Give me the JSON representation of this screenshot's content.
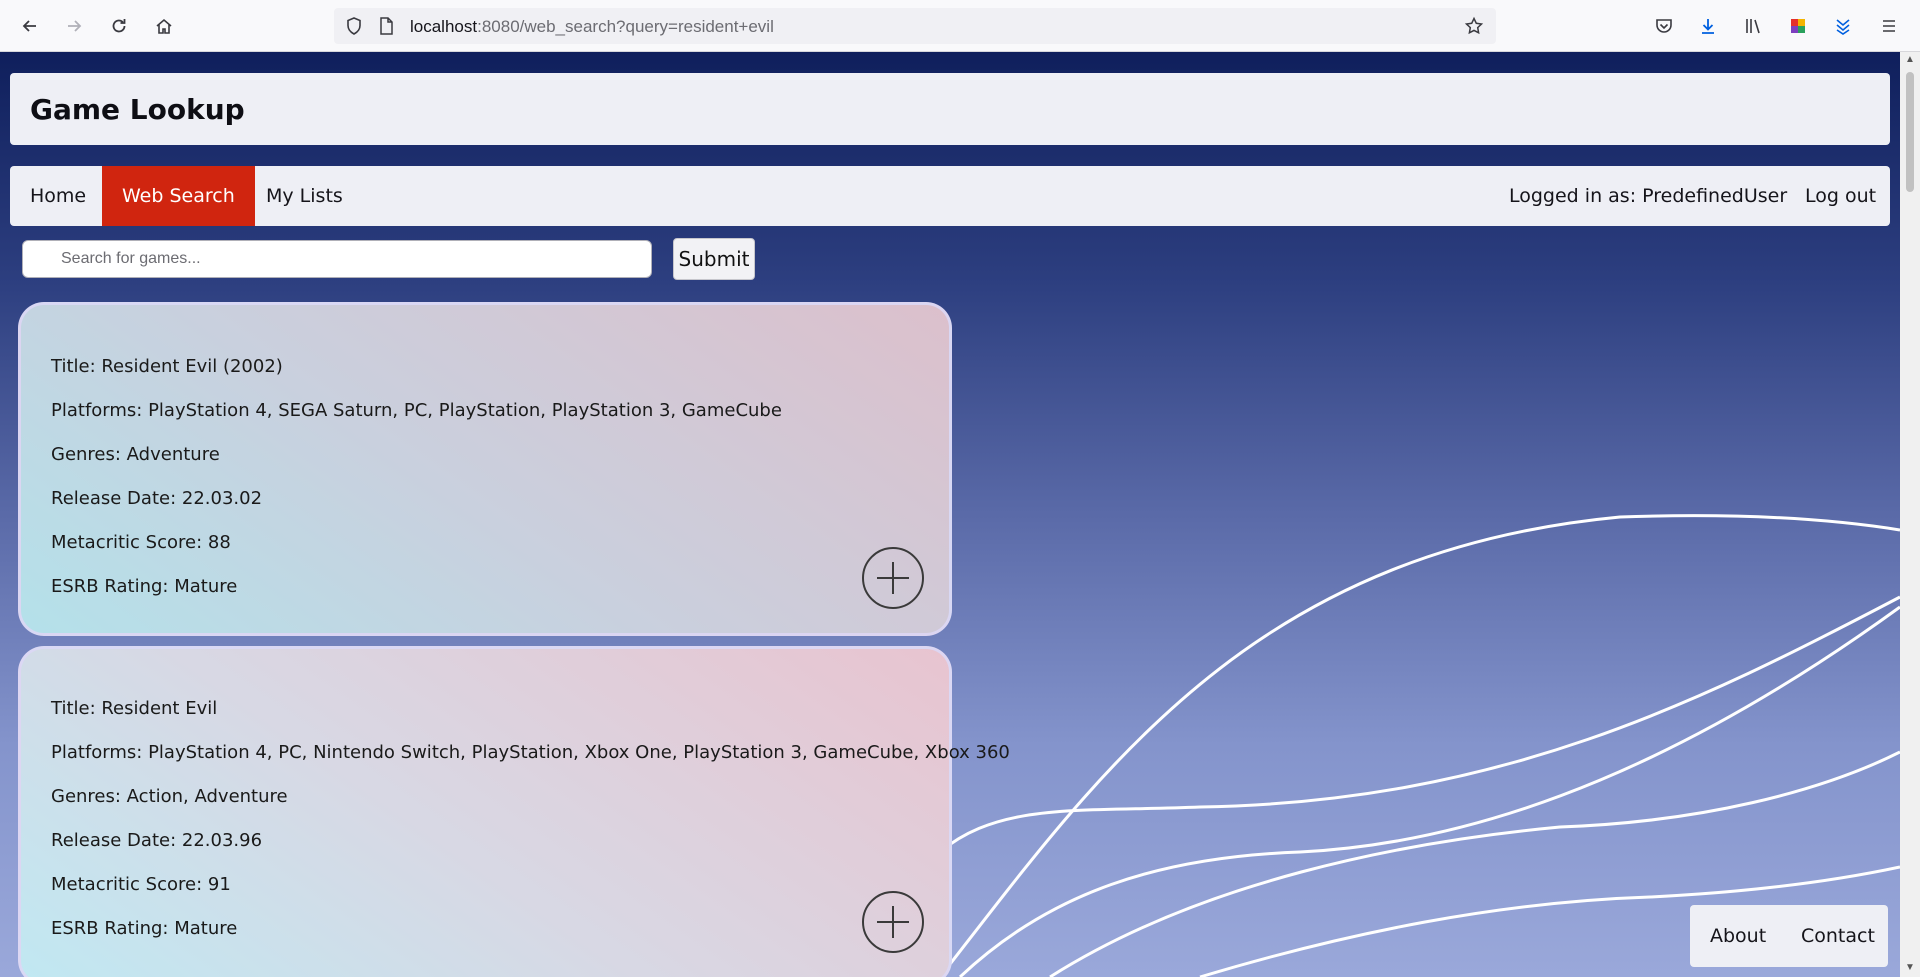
{
  "browser": {
    "url_host": "localhost",
    "url_rest": ":8080/web_search?query=resident+evil"
  },
  "app": {
    "title": "Game Lookup"
  },
  "nav": {
    "items": [
      {
        "label": "Home"
      },
      {
        "label": "Web Search"
      },
      {
        "label": "My Lists"
      }
    ],
    "logged_in": "Logged in as: PredefinedUser",
    "logout": "Log out"
  },
  "search": {
    "placeholder": "Search for games...",
    "submit_label": "Submit"
  },
  "results": [
    {
      "title": "Title: Resident Evil (2002)",
      "platforms": "Platforms: PlayStation 4, SEGA Saturn, PC, PlayStation, PlayStation 3, GameCube",
      "genres": "Genres: Adventure",
      "release": "Release Date: 22.03.02",
      "metacritic": "Metacritic Score: 88",
      "esrb": "ESRB Rating: Mature"
    },
    {
      "title": "Title: Resident Evil",
      "platforms": "Platforms: PlayStation 4, PC, Nintendo Switch, PlayStation, Xbox One, PlayStation 3, GameCube, Xbox 360",
      "genres": "Genres: Action, Adventure",
      "release": "Release Date: 22.03.96",
      "metacritic": "Metacritic Score: 91",
      "esrb": "ESRB Rating: Mature"
    }
  ],
  "footer": {
    "about": "About",
    "contact": "Contact"
  },
  "colors": {
    "accent": "#d0250f",
    "panel": "#eeeff5"
  }
}
